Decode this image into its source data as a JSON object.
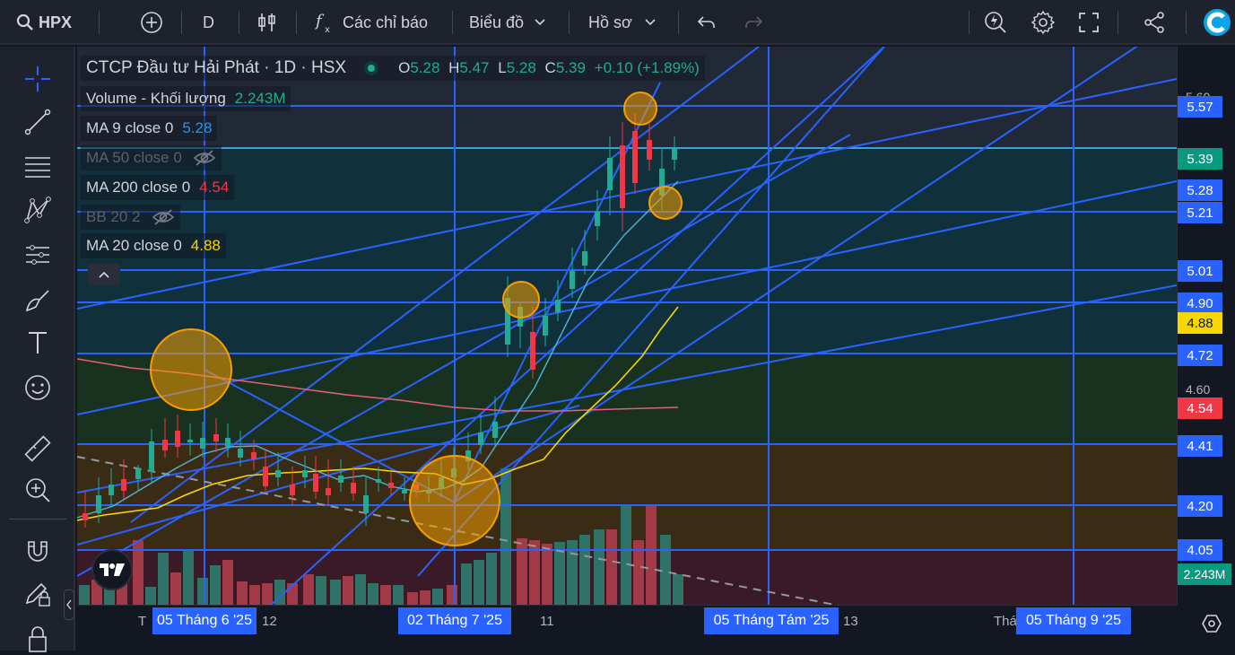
{
  "toolbar": {
    "symbol": "HPX",
    "interval": "D",
    "indicators_label": "Các chỉ báo",
    "chart_type_label": "Biểu đồ",
    "profile_label": "Hồ sơ"
  },
  "legend": {
    "title": "CTCP Đầu tư Hải Phát · 1D · HSX",
    "o_label": "O",
    "o_value": "5.28",
    "h_label": "H",
    "h_value": "5.47",
    "l_label": "L",
    "l_value": "5.28",
    "c_label": "C",
    "c_value": "5.39",
    "change": "+0.10 (+1.89%)",
    "volume_label": "Volume - Khối lượng",
    "volume_value": "2.243M",
    "ma9_label": "MA 9 close 0",
    "ma9_value": "5.28",
    "ma50_label": "MA 50 close 0",
    "ma200_label": "MA 200 close 0",
    "ma200_value": "4.54",
    "bb_label": "BB 20 2",
    "ma20_label": "MA 20 close 0",
    "ma20_value": "4.88"
  },
  "price_axis": {
    "ticks": [
      "5.60",
      "4.60"
    ],
    "labels": [
      {
        "text": "5.57",
        "color": "#2962ff"
      },
      {
        "text": "5.39",
        "color": "#089981"
      },
      {
        "text": "5.28",
        "color": "#2962ff"
      },
      {
        "text": "5.21",
        "color": "#2962ff"
      },
      {
        "text": "5.01",
        "color": "#2962ff"
      },
      {
        "text": "4.90",
        "color": "#2962ff"
      },
      {
        "text": "4.88",
        "color": "#f7d700"
      },
      {
        "text": "4.72",
        "color": "#2962ff"
      },
      {
        "text": "4.54",
        "color": "#f23645"
      },
      {
        "text": "4.41",
        "color": "#2962ff"
      },
      {
        "text": "4.20",
        "color": "#2962ff"
      },
      {
        "text": "4.05",
        "color": "#2962ff"
      },
      {
        "text": "2.243M",
        "color": "#089981"
      }
    ]
  },
  "time_axis": {
    "labels": [
      "05 Tháng 6 '25",
      "02 Tháng 7 '25",
      "05 Tháng Tám '25",
      "05 Tháng 9 '25"
    ],
    "ticks": [
      "T",
      "12",
      "11",
      "13",
      "Thá"
    ]
  },
  "colors": {
    "up": "#089981",
    "down": "#f23645",
    "drawing": "#2962ff",
    "circle": "#f59f00",
    "ma20": "#f7d700",
    "ma200": "#e0607e",
    "ma9": "#4fb3d9"
  }
}
